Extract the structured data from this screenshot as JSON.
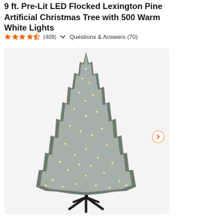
{
  "product": {
    "title": "9 ft. Pre-Lit LED Flocked Lexington Pine Artificial Christmas Tree with 500 Warm White Lights",
    "rating": 4.5,
    "rating_max": 5,
    "review_count": "(409)",
    "qa_label": "Questions & Answers (70)"
  },
  "icons": {
    "star": "star-icon",
    "expand": "chevron-down-icon",
    "next": "chevron-right-icon"
  },
  "colors": {
    "star": "#f96302",
    "accent": "#f96302"
  }
}
